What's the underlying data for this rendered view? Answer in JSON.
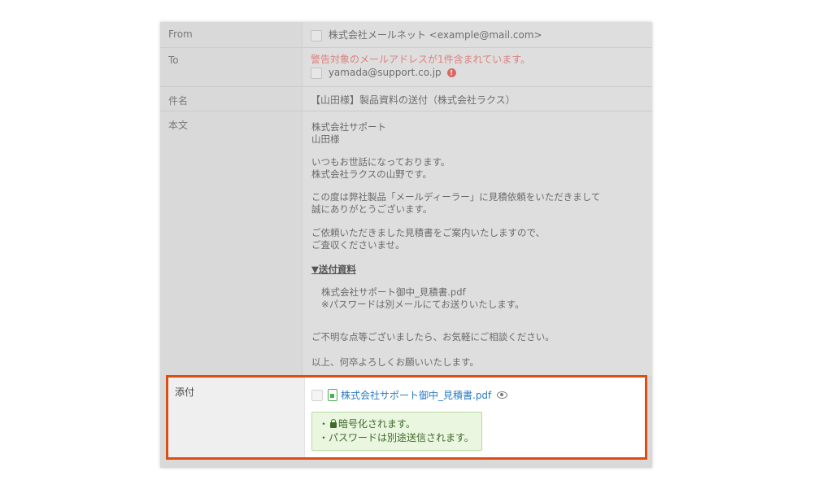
{
  "fields": {
    "from_label": "From",
    "from_value": "株式会社メールネット <example@mail.com>",
    "to_label": "To",
    "to_warning": "警告対象のメールアドレスが1件含まれています。",
    "to_value": "yamada@support.co.jp",
    "to_info_icon": "!",
    "subject_label": "件名",
    "subject_value": "【山田様】製品資料の送付（株式会社ラクス）",
    "body_label": "本文"
  },
  "body_lines": {
    "l1": "株式会社サポート",
    "l2": "山田様",
    "l3": "いつもお世話になっております。",
    "l4": "株式会社ラクスの山野です。",
    "l5": "この度は弊社製品「メールディーラー」に見積依頼をいただきまして",
    "l6": "誠にありがとうございます。",
    "l7": "ご依頼いただきました見積書をご案内いたしますので、",
    "l8": "ご査収くださいませ。",
    "section_head": "▼送付資料",
    "l9": "株式会社サポート御中_見積書.pdf",
    "l10": "※パスワードは別メールにてお送りいたします。",
    "l11": "ご不明な点等ございましたら、お気軽にご相談ください。",
    "l12": "以上、何卒よろしくお願いいたします。"
  },
  "attachment": {
    "label": "添付",
    "file_name": "株式会社サポート御中_見積書.pdf",
    "notice_line1": "暗号化されます。",
    "notice_line2": "・パスワードは別途送信されます。",
    "bullet": "・"
  },
  "colors": {
    "highlight_border": "#dc4e14",
    "warning_text": "#d9827f",
    "link": "#2a7bc4",
    "notice_bg": "#eaf6df",
    "notice_text": "#3f6a2b"
  }
}
